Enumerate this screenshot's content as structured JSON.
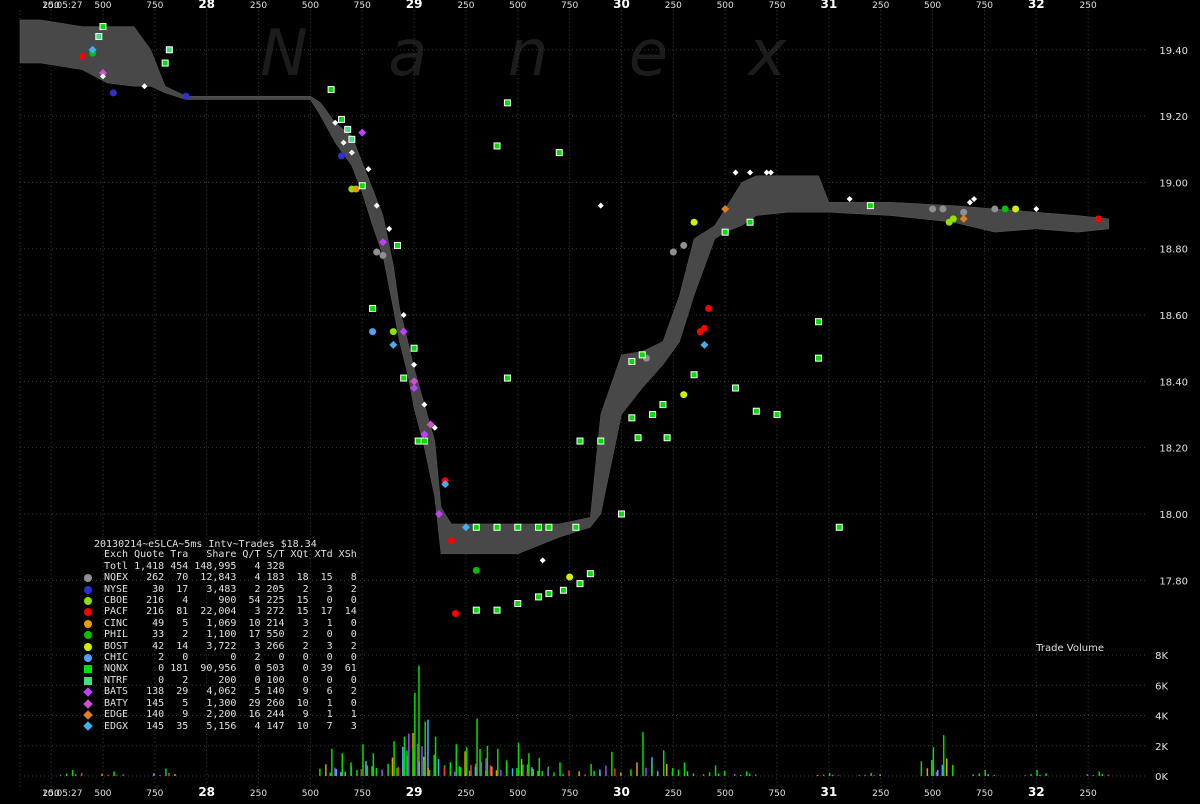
{
  "watermark": "N a n e x",
  "chart_data": {
    "type": "scatter",
    "title": "20130214~eSLCA~5ms Intv~Trades $18.34",
    "ylim": [
      17.62,
      19.52
    ],
    "ytick_labels": [
      "19.40",
      "19.20",
      "19.00",
      "18.80",
      "18.60",
      "18.40",
      "18.20",
      "18.00",
      "17.80"
    ],
    "ytick_values": [
      19.4,
      19.2,
      19.0,
      18.8,
      18.6,
      18.4,
      18.2,
      18.0,
      17.8
    ],
    "xlim": [
      27.1,
      32.5
    ],
    "xticks": [
      {
        "v": 27.1,
        "label": "10:05:27"
      },
      {
        "v": 27.25,
        "label": "250"
      },
      {
        "v": 27.5,
        "label": "500"
      },
      {
        "v": 27.75,
        "label": "750"
      },
      {
        "v": 28,
        "label": "28"
      },
      {
        "v": 28.25,
        "label": "250"
      },
      {
        "v": 28.5,
        "label": "500"
      },
      {
        "v": 28.75,
        "label": "750"
      },
      {
        "v": 29,
        "label": "29"
      },
      {
        "v": 29.25,
        "label": "250"
      },
      {
        "v": 29.5,
        "label": "500"
      },
      {
        "v": 29.75,
        "label": "750"
      },
      {
        "v": 30,
        "label": "30"
      },
      {
        "v": 30.25,
        "label": "250"
      },
      {
        "v": 30.5,
        "label": "500"
      },
      {
        "v": 30.75,
        "label": "750"
      },
      {
        "v": 31,
        "label": "31"
      },
      {
        "v": 31.25,
        "label": "250"
      },
      {
        "v": 31.5,
        "label": "500"
      },
      {
        "v": 31.75,
        "label": "750"
      },
      {
        "v": 32,
        "label": "32"
      },
      {
        "v": 32.25,
        "label": "250"
      }
    ],
    "nbbo_band": [
      [
        27.1,
        19.49,
        19.36
      ],
      [
        27.2,
        19.49,
        19.36
      ],
      [
        27.4,
        19.47,
        19.34
      ],
      [
        27.52,
        19.47,
        19.3
      ],
      [
        27.65,
        19.47,
        19.29
      ],
      [
        27.73,
        19.4,
        19.29
      ],
      [
        27.8,
        19.29,
        19.27
      ],
      [
        27.9,
        19.26,
        19.25
      ],
      [
        28.2,
        19.26,
        19.25
      ],
      [
        28.5,
        19.26,
        19.25
      ],
      [
        28.55,
        19.24,
        19.2
      ],
      [
        28.62,
        19.18,
        19.12
      ],
      [
        28.7,
        19.14,
        19.05
      ],
      [
        28.75,
        19.06,
        18.97
      ],
      [
        28.8,
        18.98,
        18.87
      ],
      [
        28.85,
        18.9,
        18.78
      ],
      [
        28.9,
        18.75,
        18.62
      ],
      [
        28.93,
        18.62,
        18.52
      ],
      [
        28.97,
        18.52,
        18.42
      ],
      [
        29.0,
        18.44,
        18.32
      ],
      [
        29.05,
        18.33,
        18.2
      ],
      [
        29.1,
        18.22,
        18.05
      ],
      [
        29.13,
        18.02,
        17.88
      ],
      [
        29.18,
        17.97,
        17.88
      ],
      [
        29.5,
        17.97,
        17.88
      ],
      [
        29.7,
        17.97,
        17.93
      ],
      [
        29.85,
        17.99,
        17.96
      ],
      [
        29.9,
        18.3,
        18.0
      ],
      [
        30.0,
        18.48,
        18.3
      ],
      [
        30.1,
        18.49,
        18.38
      ],
      [
        30.2,
        18.52,
        18.45
      ],
      [
        30.28,
        18.66,
        18.52
      ],
      [
        30.35,
        18.83,
        18.66
      ],
      [
        30.45,
        18.87,
        18.83
      ],
      [
        30.5,
        18.92,
        18.85
      ],
      [
        30.58,
        19.0,
        18.87
      ],
      [
        30.65,
        19.02,
        18.9
      ],
      [
        30.8,
        19.02,
        18.91
      ],
      [
        30.95,
        19.02,
        18.91
      ],
      [
        31.0,
        18.94,
        18.91
      ],
      [
        31.3,
        18.94,
        18.9
      ],
      [
        31.6,
        18.93,
        18.88
      ],
      [
        31.8,
        18.92,
        18.85
      ],
      [
        32.0,
        18.91,
        18.86
      ],
      [
        32.2,
        18.9,
        18.85
      ],
      [
        32.35,
        18.89,
        18.86
      ]
    ],
    "volume_label": "Trade Volume",
    "volume_axis_labels": [
      "8K",
      "6K",
      "4K",
      "2K",
      "0K"
    ],
    "volume_axis_values": [
      8000,
      6000,
      4000,
      2000,
      0
    ],
    "volume_max": 8000,
    "volume_peaks": [
      [
        27.35,
        400
      ],
      [
        27.55,
        300
      ],
      [
        27.8,
        500
      ],
      [
        28.6,
        1800
      ],
      [
        28.65,
        1500
      ],
      [
        28.75,
        2100
      ],
      [
        28.8,
        1500
      ],
      [
        28.9,
        2300
      ],
      [
        28.95,
        2600
      ],
      [
        29.0,
        5500
      ],
      [
        29.02,
        7300
      ],
      [
        29.05,
        3600
      ],
      [
        29.1,
        2600
      ],
      [
        29.2,
        2100
      ],
      [
        29.25,
        1900
      ],
      [
        29.3,
        3800
      ],
      [
        29.35,
        2000
      ],
      [
        29.4,
        1800
      ],
      [
        29.5,
        2200
      ],
      [
        29.55,
        1500
      ],
      [
        29.6,
        1200
      ],
      [
        29.7,
        900
      ],
      [
        29.85,
        800
      ],
      [
        29.95,
        1600
      ],
      [
        30.1,
        2900
      ],
      [
        30.2,
        1700
      ],
      [
        30.3,
        900
      ],
      [
        30.45,
        700
      ],
      [
        30.6,
        300
      ],
      [
        31.0,
        200
      ],
      [
        31.2,
        200
      ],
      [
        31.5,
        1900
      ],
      [
        31.55,
        2700
      ],
      [
        31.75,
        400
      ],
      [
        32.0,
        400
      ],
      [
        32.3,
        300
      ]
    ],
    "series": [
      {
        "name": "NQEX",
        "color": "#909090",
        "shape": "circle",
        "points": [
          [
            28.82,
            18.79
          ],
          [
            28.85,
            18.78
          ],
          [
            30.25,
            18.79
          ],
          [
            30.3,
            18.81
          ],
          [
            30.12,
            18.47
          ],
          [
            31.65,
            18.91
          ],
          [
            31.8,
            18.92
          ],
          [
            31.5,
            18.92
          ],
          [
            31.55,
            18.92
          ],
          [
            30.5,
            18.85
          ]
        ]
      },
      {
        "name": "NYSE",
        "color": "#3030d0",
        "shape": "circle",
        "points": [
          [
            27.55,
            19.27
          ],
          [
            27.9,
            19.26
          ],
          [
            28.65,
            19.08
          ]
        ]
      },
      {
        "name": "CBOE",
        "color": "#90e000",
        "shape": "circle",
        "points": [
          [
            28.7,
            18.98
          ],
          [
            28.9,
            18.55
          ],
          [
            31.6,
            18.89
          ],
          [
            31.58,
            18.88
          ]
        ]
      },
      {
        "name": "PACF",
        "color": "#ff0000",
        "shape": "circle",
        "points": [
          [
            29.2,
            17.7
          ],
          [
            27.4,
            19.38
          ],
          [
            29.15,
            18.1
          ],
          [
            29.18,
            17.92
          ],
          [
            30.4,
            18.56
          ],
          [
            30.38,
            18.55
          ],
          [
            30.42,
            18.62
          ],
          [
            32.3,
            18.89
          ]
        ]
      },
      {
        "name": "CINC",
        "color": "#e0a000",
        "shape": "circle",
        "points": [
          [
            28.72,
            18.98
          ]
        ]
      },
      {
        "name": "PHIL",
        "color": "#00c000",
        "shape": "circle",
        "points": [
          [
            27.45,
            19.39
          ],
          [
            31.85,
            18.92
          ],
          [
            29.3,
            17.83
          ]
        ]
      },
      {
        "name": "BOST",
        "color": "#d0f000",
        "shape": "circle",
        "points": [
          [
            29.75,
            17.81
          ],
          [
            30.35,
            18.88
          ],
          [
            31.9,
            18.92
          ],
          [
            30.3,
            18.36
          ]
        ]
      },
      {
        "name": "CHIC",
        "color": "#50a0ff",
        "shape": "circle",
        "points": [
          [
            28.8,
            18.55
          ]
        ]
      },
      {
        "name": "NQNX",
        "color": "#00e000",
        "shape": "square",
        "points": [
          [
            27.5,
            19.47
          ],
          [
            28.95,
            18.41
          ],
          [
            29.0,
            18.5
          ],
          [
            29.02,
            18.22
          ],
          [
            29.05,
            18.22
          ],
          [
            29.3,
            17.71
          ],
          [
            29.4,
            17.71
          ],
          [
            29.5,
            17.73
          ],
          [
            29.6,
            17.75
          ],
          [
            29.65,
            17.76
          ],
          [
            29.72,
            17.77
          ],
          [
            29.8,
            17.79
          ],
          [
            29.3,
            17.96
          ],
          [
            29.4,
            17.96
          ],
          [
            29.5,
            17.96
          ],
          [
            29.6,
            17.96
          ],
          [
            29.65,
            17.96
          ],
          [
            29.78,
            17.96
          ],
          [
            29.8,
            18.22
          ],
          [
            29.9,
            18.22
          ],
          [
            30.08,
            18.23
          ],
          [
            30.22,
            18.23
          ],
          [
            30.05,
            18.29
          ],
          [
            30.15,
            18.3
          ],
          [
            30.1,
            18.48
          ],
          [
            30.2,
            18.33
          ],
          [
            28.6,
            19.28
          ],
          [
            28.65,
            19.19
          ],
          [
            28.75,
            18.99
          ],
          [
            28.8,
            18.62
          ],
          [
            29.7,
            19.09
          ],
          [
            29.85,
            17.82
          ],
          [
            30.0,
            18.0
          ],
          [
            28.92,
            18.81
          ],
          [
            30.95,
            18.47
          ],
          [
            31.05,
            17.96
          ],
          [
            30.5,
            18.85
          ],
          [
            30.75,
            18.3
          ],
          [
            31.2,
            18.93
          ],
          [
            30.95,
            18.58
          ],
          [
            29.45,
            19.24
          ],
          [
            29.45,
            18.41
          ],
          [
            29.4,
            19.11
          ],
          [
            27.8,
            19.36
          ],
          [
            30.35,
            18.42
          ],
          [
            30.65,
            18.31
          ],
          [
            30.55,
            18.38
          ],
          [
            30.05,
            18.46
          ],
          [
            30.62,
            18.88
          ]
        ]
      },
      {
        "name": "NTRF",
        "color": "#40e080",
        "shape": "square",
        "points": [
          [
            27.48,
            19.44
          ],
          [
            27.82,
            19.4
          ],
          [
            28.7,
            19.13
          ],
          [
            28.68,
            19.16
          ]
        ]
      },
      {
        "name": "BATS",
        "color": "#c040ff",
        "shape": "diamond",
        "points": [
          [
            28.75,
            19.15
          ],
          [
            28.95,
            18.55
          ],
          [
            29.0,
            18.38
          ],
          [
            29.05,
            18.24
          ],
          [
            29.12,
            18.0
          ],
          [
            28.85,
            18.82
          ]
        ]
      },
      {
        "name": "BATY",
        "color": "#d050d0",
        "shape": "diamond",
        "points": [
          [
            27.5,
            19.33
          ],
          [
            29.0,
            18.4
          ],
          [
            29.08,
            18.27
          ]
        ]
      },
      {
        "name": "EDGE",
        "color": "#e08020",
        "shape": "diamond",
        "points": [
          [
            30.5,
            18.92
          ],
          [
            31.65,
            18.89
          ]
        ]
      },
      {
        "name": "EDGX",
        "color": "#40b0f0",
        "shape": "diamond",
        "points": [
          [
            27.45,
            19.4
          ],
          [
            29.25,
            17.96
          ],
          [
            30.4,
            18.51
          ],
          [
            28.9,
            18.51
          ],
          [
            29.15,
            18.09
          ]
        ]
      }
    ],
    "white_trades": [
      [
        27.5,
        19.32
      ],
      [
        27.7,
        19.29
      ],
      [
        28.62,
        19.18
      ],
      [
        28.66,
        19.12
      ],
      [
        28.7,
        19.09
      ],
      [
        28.78,
        19.04
      ],
      [
        28.82,
        18.93
      ],
      [
        28.88,
        18.86
      ],
      [
        28.95,
        18.6
      ],
      [
        29.0,
        18.45
      ],
      [
        29.05,
        18.33
      ],
      [
        29.1,
        18.26
      ],
      [
        29.62,
        17.86
      ],
      [
        29.9,
        18.93
      ],
      [
        30.55,
        19.03
      ],
      [
        30.62,
        19.03
      ],
      [
        30.7,
        19.03
      ],
      [
        30.72,
        19.03
      ],
      [
        31.1,
        18.95
      ],
      [
        31.7,
        18.95
      ],
      [
        32.0,
        18.92
      ],
      [
        31.68,
        18.94
      ]
    ],
    "stats_header": [
      "Exch",
      "Quote",
      "Tra",
      "Share",
      "Q/T",
      "S/T",
      "XQt",
      "XTd",
      "XSh"
    ],
    "stats_total": [
      "Totl",
      "1,418",
      "454",
      "148,995",
      "4",
      "328",
      "",
      "",
      ""
    ],
    "stats_rows": [
      [
        "NQEX",
        "262",
        "70",
        "12,843",
        "4",
        "183",
        "18",
        "15",
        "8"
      ],
      [
        "NYSE",
        "30",
        "17",
        "3,483",
        "2",
        "205",
        "2",
        "3",
        "2"
      ],
      [
        "CBOE",
        "216",
        "4",
        "900",
        "54",
        "225",
        "15",
        "0",
        "0"
      ],
      [
        "PACF",
        "216",
        "81",
        "22,004",
        "3",
        "272",
        "15",
        "17",
        "14"
      ],
      [
        "CINC",
        "49",
        "5",
        "1,069",
        "10",
        "214",
        "3",
        "1",
        "0"
      ],
      [
        "PHIL",
        "33",
        "2",
        "1,100",
        "17",
        "550",
        "2",
        "0",
        "0"
      ],
      [
        "BOST",
        "42",
        "14",
        "3,722",
        "3",
        "266",
        "2",
        "3",
        "2"
      ],
      [
        "CHIC",
        "2",
        "0",
        "0",
        "2",
        "0",
        "0",
        "0",
        "0"
      ],
      [
        "NQNX",
        "0",
        "181",
        "90,956",
        "0",
        "503",
        "0",
        "39",
        "61"
      ],
      [
        "NTRF",
        "0",
        "2",
        "200",
        "0",
        "100",
        "0",
        "0",
        "0"
      ],
      [
        "BATS",
        "138",
        "29",
        "4,062",
        "5",
        "140",
        "9",
        "6",
        "2"
      ],
      [
        "BATY",
        "145",
        "5",
        "1,300",
        "29",
        "260",
        "10",
        "1",
        "0"
      ],
      [
        "EDGE",
        "140",
        "9",
        "2,200",
        "16",
        "244",
        "9",
        "1",
        "1"
      ],
      [
        "EDGX",
        "145",
        "35",
        "5,156",
        "4",
        "147",
        "10",
        "7",
        "3"
      ]
    ],
    "stats_colors": [
      "#909090",
      "#3030d0",
      "#90e000",
      "#ff0000",
      "#e0a000",
      "#00c000",
      "#d0f000",
      "#50a0ff",
      "#00e000",
      "#40e080",
      "#c040ff",
      "#d050d0",
      "#e08020",
      "#40b0f0"
    ],
    "stats_shapes": [
      "circle",
      "circle",
      "circle",
      "circle",
      "circle",
      "circle",
      "circle",
      "circle",
      "square",
      "square",
      "diamond",
      "diamond",
      "diamond",
      "diamond"
    ]
  }
}
